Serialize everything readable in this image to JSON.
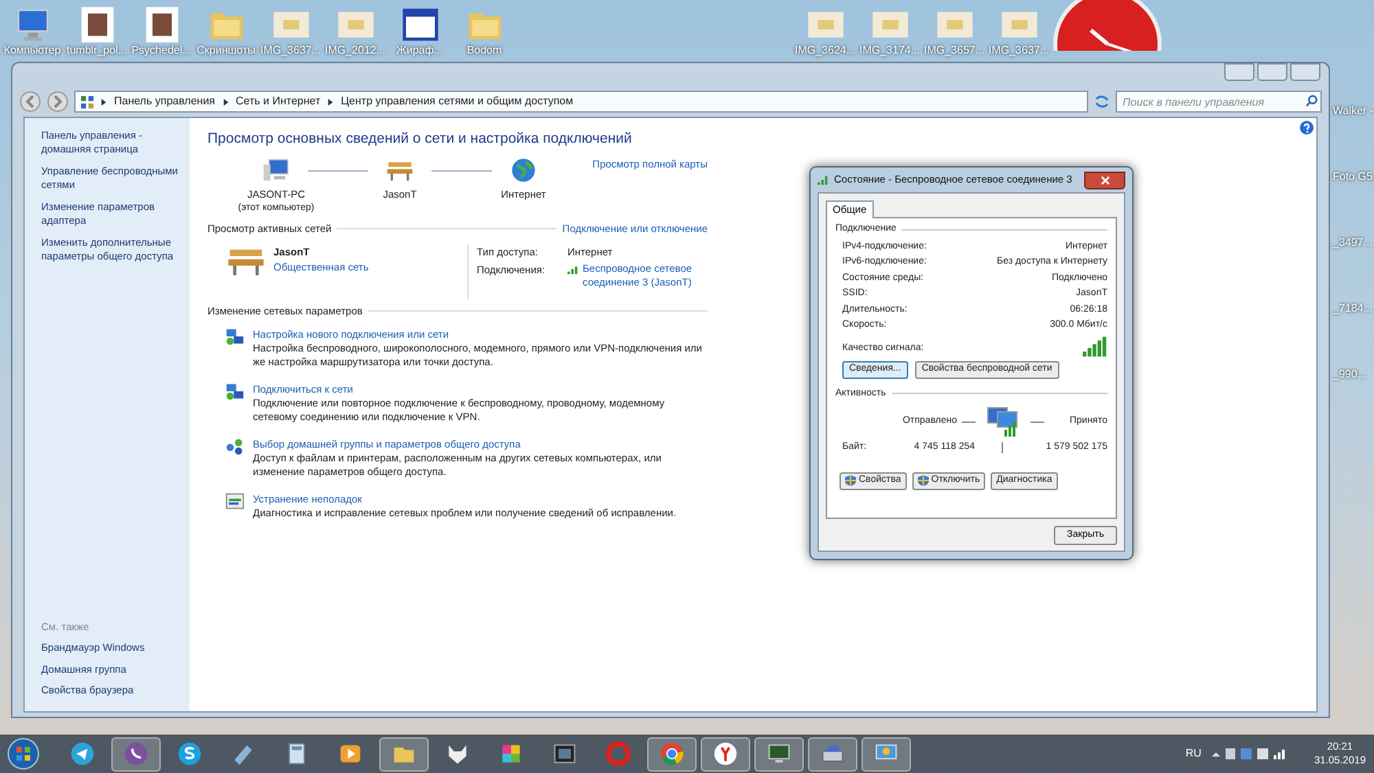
{
  "desktop": {
    "icons": [
      {
        "label": "Компьютер",
        "kind": "computer"
      },
      {
        "label": "tumblr_pol...",
        "kind": "image"
      },
      {
        "label": "Psychedel...",
        "kind": "image"
      },
      {
        "label": "Скриншоты",
        "kind": "folder"
      },
      {
        "label": "IMG_3637...",
        "kind": "photo"
      },
      {
        "label": "IMG_2012...",
        "kind": "photo"
      },
      {
        "label": "Жираф...",
        "kind": "window"
      },
      {
        "label": "Bodom",
        "kind": "folder"
      }
    ],
    "icons_right": [
      {
        "label": "IMG_3624...",
        "kind": "photo"
      },
      {
        "label": "IMG_3174...",
        "kind": "photo"
      },
      {
        "label": "IMG_3657...",
        "kind": "photo"
      },
      {
        "label": "IMG_3637...",
        "kind": "photo"
      }
    ],
    "side_icons": [
      {
        "label": "Walker -"
      },
      {
        "label": "Foto G5"
      },
      {
        "label": "_3497..."
      },
      {
        "label": "_7184..."
      },
      {
        "label": "_990..."
      }
    ]
  },
  "explorer": {
    "breadcrumb": [
      "Панель управления",
      "Сеть и Интернет",
      "Центр управления сетями и общим доступом"
    ],
    "search": {
      "placeholder": "Поиск в панели управления"
    },
    "sidebar": {
      "links": [
        "Панель управления - домашняя страница",
        "Управление беспроводными сетями",
        "Изменение параметров адаптера",
        "Изменить дополнительные параметры общего доступа"
      ],
      "see_also_title": "См. также",
      "see_also": [
        "Брандмауэр Windows",
        "Домашняя группа",
        "Свойства браузера"
      ]
    },
    "title": "Просмотр основных сведений о сети и настройка подключений",
    "full_map_link": "Просмотр полной карты",
    "map": [
      {
        "kind": "computer",
        "label": "JASONT-PC",
        "sublabel": "(этот компьютер)"
      },
      {
        "kind": "bench",
        "label": "JasonT"
      },
      {
        "kind": "globe",
        "label": "Интернет"
      }
    ],
    "active_header": "Просмотр активных сетей",
    "connect_link": "Подключение или отключение",
    "network": {
      "name": "JasonT",
      "type": "Общественная сеть",
      "access_label": "Тип доступа:",
      "access": "Интернет",
      "connections_label": "Подключения:",
      "connection": "Беспроводное сетевое соединение 3 (JasonT)"
    },
    "settings_header": "Изменение сетевых параметров",
    "tasks": [
      {
        "kind": "network",
        "title": "Настройка нового подключения или сети",
        "description": "Настройка беспроводного, широкополосного, модемного, прямого или VPN-подключения или же настройка маршрутизатора или точки доступа."
      },
      {
        "kind": "network",
        "title": "Подключиться к сети",
        "description": "Подключение или повторное подключение к беспроводному, проводному, модемному сетевому соединению или подключение к VPN."
      },
      {
        "kind": "group",
        "title": "Выбор домашней группы и параметров общего доступа",
        "description": "Доступ к файлам и принтерам, расположенным на других сетевых компьютерах, или изменение параметров общего доступа."
      },
      {
        "kind": "troubleshoot",
        "title": "Устранение неполадок",
        "description": "Диагностика и исправление сетевых проблем или получение сведений об исправлении."
      }
    ]
  },
  "dialog": {
    "title": "Состояние - Беспроводное сетевое соединение 3",
    "tabs": [
      {
        "label": "Общие",
        "selected": true
      }
    ],
    "connection_header": "Подключение",
    "rows": [
      {
        "label": "IPv4-подключение:",
        "value": "Интернет"
      },
      {
        "label": "IPv6-подключение:",
        "value": "Без доступа к Интернету"
      },
      {
        "label": "Состояние среды:",
        "value": "Подключено"
      },
      {
        "label": "SSID:",
        "value": "JasonT"
      },
      {
        "label": "Длительность:",
        "value": "06:26:18"
      },
      {
        "label": "Скорость:",
        "value": "300.0 Мбит/с"
      }
    ],
    "signal_label": "Качество сигнала:",
    "buttons": [
      {
        "label": "Сведения...",
        "focused": true
      },
      {
        "label": "Свойства беспроводной сети",
        "focused": false
      }
    ],
    "activity_header": "Активность",
    "sent_label": "Отправлено",
    "received_label": "Принято",
    "bytes_label": "Байт:",
    "sent": "4 745 118 254",
    "received": "1 579 502 175",
    "actions": [
      {
        "label": "Свойства",
        "shield": true
      },
      {
        "label": "Отключить",
        "shield": true
      },
      {
        "label": "Диагностика",
        "shield": false
      }
    ],
    "close": "Закрыть"
  },
  "taskbar": {
    "apps": [
      {
        "kind": "telegram",
        "running": false
      },
      {
        "kind": "viber",
        "running": true
      },
      {
        "kind": "skype",
        "running": false
      },
      {
        "kind": "notes",
        "running": false
      },
      {
        "kind": "calculator",
        "running": false
      },
      {
        "kind": "player",
        "running": false
      },
      {
        "kind": "folder",
        "running": true
      },
      {
        "kind": "fox",
        "running": false
      },
      {
        "kind": "paint",
        "running": false
      },
      {
        "kind": "film",
        "running": false
      },
      {
        "kind": "opera",
        "running": false
      },
      {
        "kind": "chrome",
        "running": true
      },
      {
        "kind": "yandex",
        "running": true
      },
      {
        "kind": "monitor",
        "running": true
      },
      {
        "kind": "scanner",
        "running": true
      },
      {
        "kind": "network",
        "running": true
      }
    ],
    "language": "RU",
    "time": "20:21",
    "date": "31.05.2019"
  }
}
